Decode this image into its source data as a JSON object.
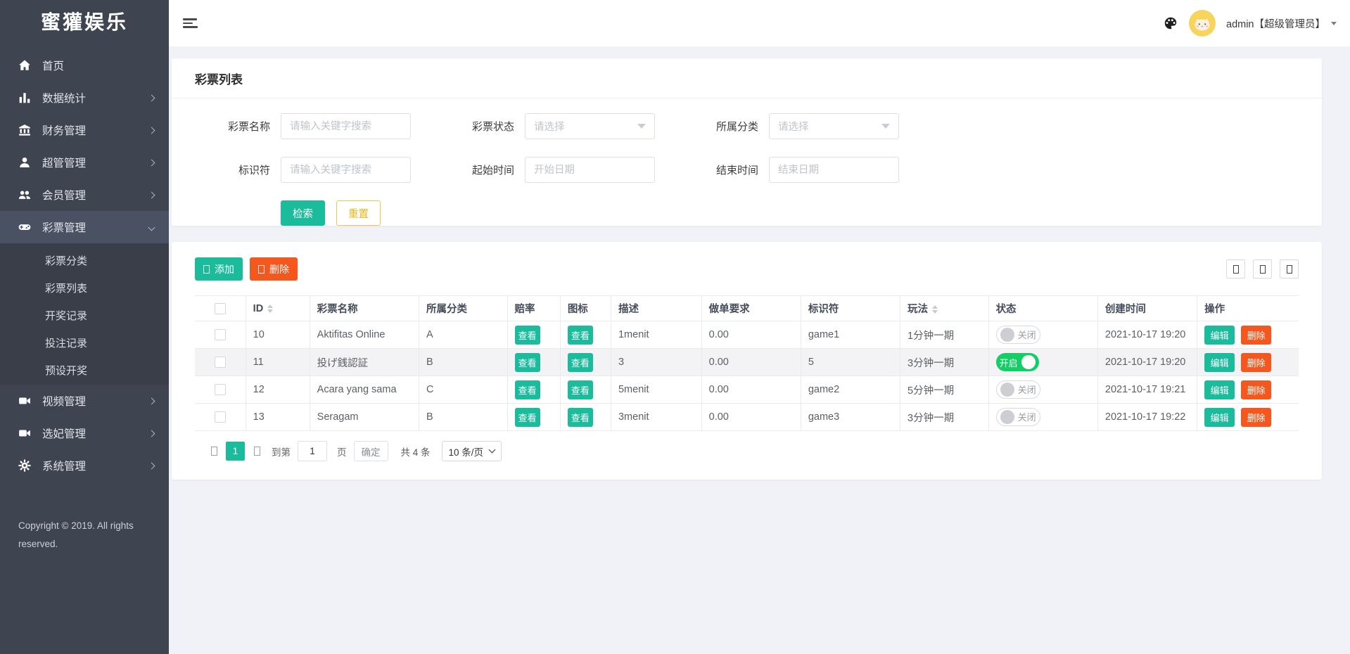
{
  "sidebar": {
    "logo": "蜜獾娱乐",
    "items": [
      {
        "key": "home",
        "label": "首页",
        "icon": "home-icon",
        "chevron": false,
        "active": false
      },
      {
        "key": "stats",
        "label": "数据统计",
        "icon": "chart-icon",
        "chevron": true,
        "active": false
      },
      {
        "key": "finance",
        "label": "财务管理",
        "icon": "bank-icon",
        "chevron": true,
        "active": false
      },
      {
        "key": "admins",
        "label": "超管管理",
        "icon": "user-icon",
        "chevron": true,
        "active": false
      },
      {
        "key": "members",
        "label": "会员管理",
        "icon": "users-icon",
        "chevron": true,
        "active": false
      },
      {
        "key": "lottery",
        "label": "彩票管理",
        "icon": "gamepad-icon",
        "chevron": true,
        "active": true,
        "expanded": true,
        "children": [
          {
            "key": "lottery-category",
            "label": "彩票分类"
          },
          {
            "key": "lottery-list",
            "label": "彩票列表"
          },
          {
            "key": "draw-records",
            "label": "开奖记录"
          },
          {
            "key": "bet-records",
            "label": "投注记录"
          },
          {
            "key": "preset-draw",
            "label": "预设开奖"
          }
        ]
      },
      {
        "key": "video",
        "label": "视频管理",
        "icon": "video-icon",
        "chevron": true,
        "active": false
      },
      {
        "key": "concubine",
        "label": "选妃管理",
        "icon": "video-icon",
        "chevron": true,
        "active": false
      },
      {
        "key": "system",
        "label": "系统管理",
        "icon": "gear-icon",
        "chevron": true,
        "active": false
      }
    ],
    "copyright": "Copyright © 2019. All rights reserved."
  },
  "topbar": {
    "username": "admin【超级管理员】"
  },
  "page": {
    "title": "彩票列表"
  },
  "filters": {
    "fields": [
      {
        "label": "彩票名称",
        "type": "text",
        "placeholder": "请输入关键字搜索"
      },
      {
        "label": "彩票状态",
        "type": "select",
        "placeholder": "请选择"
      },
      {
        "label": "所属分类",
        "type": "select",
        "placeholder": "请选择"
      },
      {
        "label": "标识符",
        "type": "text",
        "placeholder": "请输入关键字搜索"
      },
      {
        "label": "起始时间",
        "type": "text",
        "placeholder": "开始日期"
      },
      {
        "label": "结束时间",
        "type": "text",
        "placeholder": "结束日期"
      }
    ],
    "search_label": "检索",
    "reset_label": "重置"
  },
  "toolbar": {
    "add_label": "添加",
    "delete_label": "删除"
  },
  "table": {
    "columns": [
      {
        "key": "id",
        "label": "ID",
        "sortable": true
      },
      {
        "key": "name",
        "label": "彩票名称",
        "sortable": false
      },
      {
        "key": "category",
        "label": "所属分类",
        "sortable": false
      },
      {
        "key": "odds",
        "label": "赔率",
        "sortable": false
      },
      {
        "key": "icon",
        "label": "图标",
        "sortable": false
      },
      {
        "key": "desc",
        "label": "描述",
        "sortable": false
      },
      {
        "key": "requirement",
        "label": "做单要求",
        "sortable": false
      },
      {
        "key": "identifier",
        "label": "标识符",
        "sortable": false
      },
      {
        "key": "play",
        "label": "玩法",
        "sortable": true
      },
      {
        "key": "status",
        "label": "状态",
        "sortable": false
      },
      {
        "key": "created",
        "label": "创建时间",
        "sortable": false
      },
      {
        "key": "actions",
        "label": "操作",
        "sortable": false
      }
    ],
    "view_label": "查看",
    "edit_label": "编辑",
    "delete_label": "删除",
    "status_on": "开启",
    "status_off": "关闭",
    "rows": [
      {
        "id": "10",
        "name": "Aktifitas Online",
        "category": "A",
        "desc": "1menit",
        "requirement": "0.00",
        "identifier": "game1",
        "play": "1分钟一期",
        "status": "off",
        "created": "2021-10-17 19:20",
        "highlight": false
      },
      {
        "id": "11",
        "name": "投げ銭認証",
        "category": "B",
        "desc": "3",
        "requirement": "0.00",
        "identifier": "5",
        "play": "3分钟一期",
        "status": "on",
        "created": "2021-10-17 19:20",
        "highlight": true
      },
      {
        "id": "12",
        "name": "Acara yang sama",
        "category": "C",
        "desc": "5menit",
        "requirement": "0.00",
        "identifier": "game2",
        "play": "5分钟一期",
        "status": "off",
        "created": "2021-10-17 19:21",
        "highlight": false
      },
      {
        "id": "13",
        "name": "Seragam",
        "category": "B",
        "desc": "3menit",
        "requirement": "0.00",
        "identifier": "game3",
        "play": "3分钟一期",
        "status": "off",
        "created": "2021-10-17 19:22",
        "highlight": false
      }
    ]
  },
  "pagination": {
    "current_page": "1",
    "goto_label": "到第",
    "page_input": "1",
    "page_unit": "页",
    "confirm_label": "确定",
    "total_label": "共 4 条",
    "page_size": "10 条/页"
  },
  "colors": {
    "teal": "#1abc9c",
    "orange": "#f4581f",
    "toggle_on_green": "#13ce66",
    "reset_gold": "#efb312",
    "sidebar_bg": "#3e4450",
    "sidebar_active_bg": "#4a5162",
    "content_bg": "#f0f2f7"
  }
}
